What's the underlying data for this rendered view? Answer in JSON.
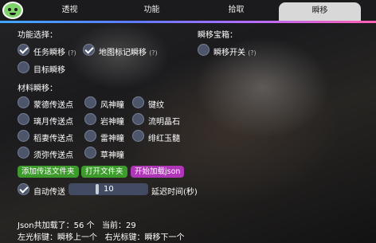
{
  "tabs": [
    "透视",
    "功能",
    "拾取",
    "瞬移"
  ],
  "active_tab": "瞬移",
  "function_select": {
    "title": "功能选择：",
    "task_teleport": "任务瞬移",
    "map_marker_teleport": "地图标记瞬移",
    "target_teleport": "目标瞬移",
    "help": "(?)"
  },
  "teleport_chest": {
    "title": "瞬移宝箱：",
    "teleport_switch": "瞬移开关",
    "help": "(?)"
  },
  "material_teleport": {
    "title": "材料瞬移：",
    "col1": [
      "蒙德传送点",
      "璃月传送点",
      "稻妻传送点",
      "须弥传送点"
    ],
    "col2": [
      "风神瞳",
      "岩神瞳",
      "雷神瞳",
      "草神瞳"
    ],
    "col3": [
      "键纹",
      "流明晶石",
      "绯红玉髓"
    ]
  },
  "buttons": {
    "add_folder": "添加传送文件夹",
    "open_folder": "打开文件夹",
    "load_json": "开始加载json"
  },
  "auto_teleport": {
    "label": "自动传送",
    "delay_value": "10",
    "delay_label": "延迟时间(秒)",
    "delay_fraction": 0.35
  },
  "status": {
    "loaded": "Json共加载了：56 个   当前：29",
    "hint": "左光标键：瞬移上一个   右光标键：瞬移下一个"
  },
  "colors": {
    "accent_green": "#3d9b2c",
    "accent_purple": "#b036b8",
    "tab_active_bg": "#d8d8d8"
  }
}
